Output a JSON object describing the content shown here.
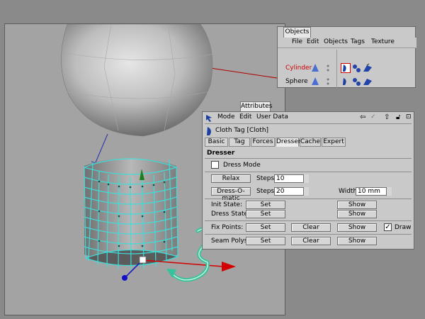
{
  "objects_window": {
    "tab_label": "Objects",
    "menu": [
      "File",
      "Edit",
      "Objects",
      "Tags",
      "Texture"
    ],
    "rows": [
      {
        "name": "Cylinder",
        "color": "#cc0000"
      },
      {
        "name": "Sphere",
        "color": "#000000"
      }
    ]
  },
  "attributes_window": {
    "tab_label": "Attributes",
    "menu": [
      "Mode",
      "Edit",
      "User Data"
    ],
    "tag_title": "Cloth Tag [Cloth]",
    "tabs": [
      "Basic",
      "Tag",
      "Forces",
      "Dresser",
      "Cache",
      "Expert"
    ],
    "active_tab": "Dresser",
    "section": "Dresser",
    "dress_mode_label": "Dress Mode",
    "relax_label": "Relax",
    "steps_label": "Steps",
    "relax_steps": "10",
    "dressomatic_label": "Dress-O-matic",
    "dress_steps": "20",
    "width_label": "Width",
    "width_value": "10 mm",
    "init_state_label": "Init State:",
    "dress_state_label": "Dress State:",
    "fix_points_label": "Fix Points:",
    "seam_polys_label": "Seam Polys:",
    "set_label": "Set",
    "clear_label": "Clear",
    "show_label": "Show",
    "draw_label": "Draw",
    "draw_checked": "✓"
  },
  "colors": {
    "wire": "#3fdcd8",
    "annotation_arrow": "#36c29a",
    "axis_x": "#d40000",
    "axis_y": "#1c7d1c",
    "axis_z": "#1010c8"
  }
}
